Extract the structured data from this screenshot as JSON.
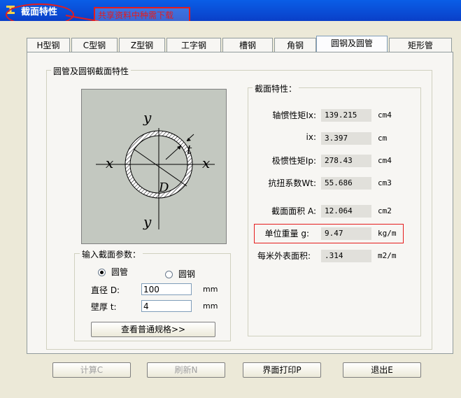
{
  "window": {
    "title": "截面特性"
  },
  "annotation": {
    "note": "共享资料中种需下载"
  },
  "tabs": [
    {
      "label": "H型钢"
    },
    {
      "label": "C型钢"
    },
    {
      "label": "Z型钢"
    },
    {
      "label": "工字钢"
    },
    {
      "label": "槽钢"
    },
    {
      "label": "角钢"
    },
    {
      "label": "圆钢及圆管"
    },
    {
      "label": "矩形管"
    }
  ],
  "section_group": {
    "title": "圆管及圆钢截面特性"
  },
  "diagram": {
    "y_top": "y",
    "y_bottom": "y",
    "x_left": "x",
    "x_right": "x",
    "t": "t",
    "D": "D"
  },
  "input_group": {
    "title": "输入截面参数：",
    "radio_tube": "圆管",
    "radio_bar": "圆钢",
    "diameter_label": "直径 D:",
    "diameter_value": "100",
    "diameter_unit": "mm",
    "thickness_label": "壁厚 t:",
    "thickness_value": "4",
    "thickness_unit": "mm",
    "spec_button": "查看普通规格>>"
  },
  "props_group": {
    "title": "截面特性：",
    "rows": [
      {
        "label": "轴惯性矩Ix:",
        "value": "139.215",
        "unit": "cm4"
      },
      {
        "label": "ix:",
        "value": "3.397",
        "unit": "cm"
      },
      {
        "label": "极惯性矩Ip:",
        "value": "278.43",
        "unit": "cm4"
      },
      {
        "label": "抗扭系数Wt:",
        "value": "55.686",
        "unit": "cm3"
      },
      {
        "label": "截面面积 A:",
        "value": "12.064",
        "unit": "cm2"
      },
      {
        "label": "单位重量 g:",
        "value": "9.47",
        "unit": "kg/m"
      },
      {
        "label": "每米外表面积:",
        "value": ".314",
        "unit": "m2/m"
      }
    ]
  },
  "buttons": {
    "calc": "计算C",
    "refresh": "刷新N",
    "print": "界面打印P",
    "exit": "退出E"
  }
}
